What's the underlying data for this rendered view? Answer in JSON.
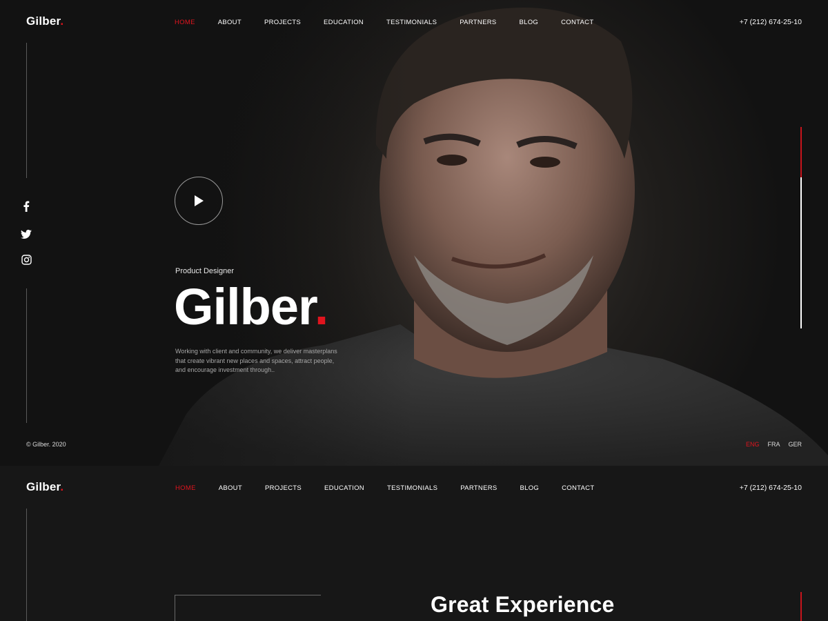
{
  "brand": {
    "name": "Gilber",
    "dot": "."
  },
  "nav": {
    "items": [
      "HOME",
      "ABOUT",
      "PROJECTS",
      "EDUCATION",
      "TESTIMONIALS",
      "PARTNERS",
      "BLOG",
      "CONTACT"
    ],
    "active": "HOME"
  },
  "phone": "+7 (212) 674-25-10",
  "social": [
    "facebook-icon",
    "twitter-icon",
    "instagram-icon"
  ],
  "hero": {
    "subtitle": "Product Designer",
    "name": "Gilber",
    "name_dot": ".",
    "description": "Working with client and community, we deliver masterplans that create vibrant new places and spaces, attract people, and encourage investment through..",
    "copyright": "© Gilber. 2020",
    "languages": [
      "ENG",
      "FRA",
      "GER"
    ],
    "active_language": "ENG",
    "scroll_progress": 0.25
  },
  "section2": {
    "heading": "Great Experience"
  },
  "colors": {
    "accent": "#e0141e",
    "background": "#141414",
    "text": "#ffffff"
  }
}
